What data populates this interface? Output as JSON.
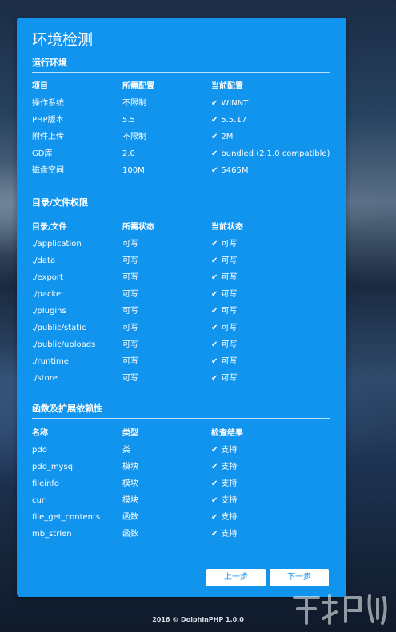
{
  "title": "环境检测",
  "sections": {
    "env": {
      "title": "运行环境",
      "headers": [
        "项目",
        "所需配置",
        "当前配置"
      ],
      "rows": [
        [
          "操作系统",
          "不限制",
          "WINNT"
        ],
        [
          "PHP版本",
          "5.5",
          "5.5.17"
        ],
        [
          "附件上传",
          "不限制",
          "2M"
        ],
        [
          "GD库",
          "2.0",
          "bundled (2.1.0 compatible)"
        ],
        [
          "磁盘空间",
          "100M",
          "5465M"
        ]
      ]
    },
    "dirs": {
      "title": "目录/文件权限",
      "headers": [
        "目录/文件",
        "所需状态",
        "当前状态"
      ],
      "rows": [
        [
          "./application",
          "可写",
          "可写"
        ],
        [
          "./data",
          "可写",
          "可写"
        ],
        [
          "./export",
          "可写",
          "可写"
        ],
        [
          "./packet",
          "可写",
          "可写"
        ],
        [
          "./plugins",
          "可写",
          "可写"
        ],
        [
          "./public/static",
          "可写",
          "可写"
        ],
        [
          "./public/uploads",
          "可写",
          "可写"
        ],
        [
          "./runtime",
          "可写",
          "可写"
        ],
        [
          "./store",
          "可写",
          "可写"
        ]
      ]
    },
    "funcs": {
      "title": "函数及扩展依赖性",
      "headers": [
        "名称",
        "类型",
        "检查结果"
      ],
      "rows": [
        [
          "pdo",
          "类",
          "支持"
        ],
        [
          "pdo_mysql",
          "模块",
          "支持"
        ],
        [
          "fileinfo",
          "模块",
          "支持"
        ],
        [
          "curl",
          "模块",
          "支持"
        ],
        [
          "file_get_contents",
          "函数",
          "支持"
        ],
        [
          "mb_strlen",
          "函数",
          "支持"
        ]
      ]
    }
  },
  "buttons": {
    "prev": "上一步",
    "next": "下一步"
  },
  "footer": "2016 © DolphinPHP 1.0.0",
  "icons": {
    "check": "check-icon"
  },
  "colors": {
    "card": "#1194ee",
    "button_text": "#1b8fe6"
  }
}
